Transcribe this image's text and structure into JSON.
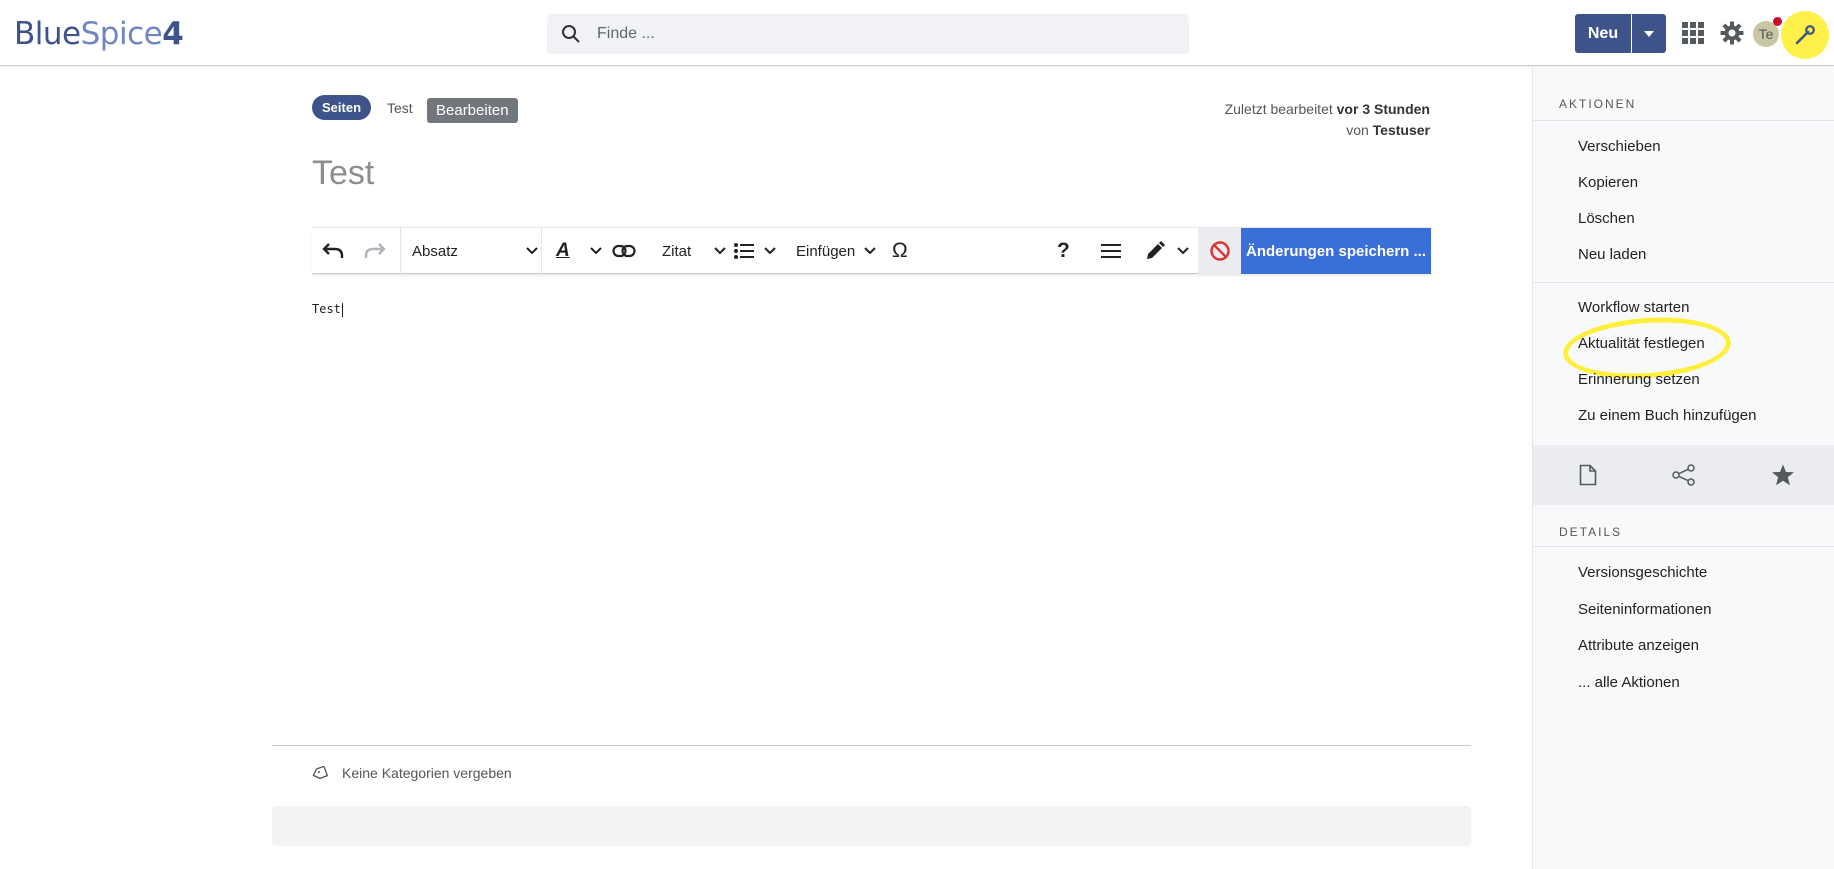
{
  "header": {
    "logo": {
      "part1": "Blue",
      "part2": "Spice",
      "part3": "4"
    },
    "search": {
      "placeholder": "Finde ..."
    },
    "new_button": "Neu",
    "avatar_initials": "Te",
    "icons": [
      "search-icon",
      "caret-down-icon",
      "apps-grid-icon",
      "gear-icon",
      "wrench-icon"
    ],
    "colors": {
      "brand": "#3e5389",
      "highlight": "#fff04a"
    }
  },
  "page": {
    "breadcrumb": {
      "namespace": "Seiten",
      "page": "Test"
    },
    "mode_badge": "Bearbeiten",
    "last_edit": {
      "prefix": "Zuletzt bearbeitet",
      "when": "vor 3 Stunden",
      "by_prefix": "von",
      "user": "Testuser"
    },
    "title": "Test"
  },
  "toolbar": {
    "format": "Absatz",
    "quote": "Zitat",
    "insert": "Einfügen",
    "special_char": "Ω",
    "help": "?",
    "save": "Änderungen speichern ...",
    "colors": {
      "save": "#3a6fd8",
      "cancel": "#d33"
    }
  },
  "editor": {
    "content": "Test"
  },
  "categories": {
    "text": "Keine Kategorien vergeben"
  },
  "sidebar": {
    "actions_heading": "AKTIONEN",
    "actions_group1": [
      "Verschieben",
      "Kopieren",
      "Löschen",
      "Neu laden"
    ],
    "actions_group2": [
      "Workflow starten",
      "Aktualität festlegen",
      "Erinnerung setzen",
      "Zu einem Buch hinzufügen"
    ],
    "icon_row": [
      "page-icon",
      "share-icon",
      "star-icon"
    ],
    "details_heading": "DETAILS",
    "details": [
      "Versionsgeschichte",
      "Seiteninformationen",
      "Attribute anzeigen",
      "... alle Aktionen"
    ]
  }
}
